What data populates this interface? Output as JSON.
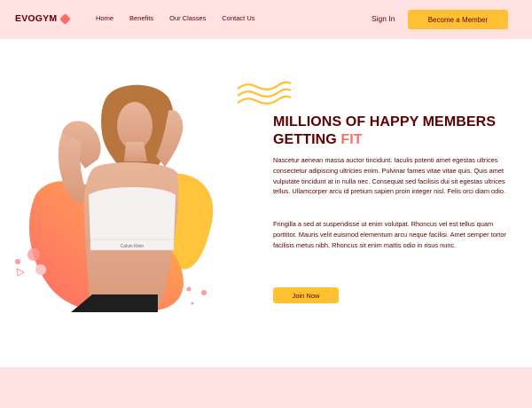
{
  "brand": {
    "name": "EVOGYM"
  },
  "nav": {
    "links": [
      "Home",
      "Benefits",
      "Our Classes",
      "Contact Us"
    ],
    "sign_in": "Sign In",
    "cta": "Become a Member"
  },
  "hero": {
    "title_line1": "MILLIONS OF HAPPY MEMBERS",
    "title_line2_prefix": "GETTING ",
    "title_highlight": "FIT",
    "paragraph1": "Nascetur aenean massa auctor tincidunt. Iaculis potenti amet egestas ultrices consectetur adipiscing ultricies enim. Pulvinar fames vitae vitae quis. Quis amet vulputate tincidunt at in nulla nec. Consequat sed facilisis dui sit egestas ultrices tellus. Ullamcorper arcu id pretium sapien proin integer nisl. Felis orci diam odio.",
    "paragraph2": "Fringilla a sed at suspendisse ut enim volutpat. Rhoncus vel est tellus quam porttitor. Mauris velit euismod elementum arcu neque facilisi. Amet semper tortor facilisis metus nibh. Rhoncus sit enim mattis odio in risus nunc.",
    "join_button": "Join Now",
    "top_text": "Calvin Klein",
    "image_icon": "woman-fitness-image"
  },
  "colors": {
    "primary": "#ffe1e1",
    "accent": "#ffc132",
    "secondary": "#ff6b66",
    "text": "#5e0000"
  }
}
